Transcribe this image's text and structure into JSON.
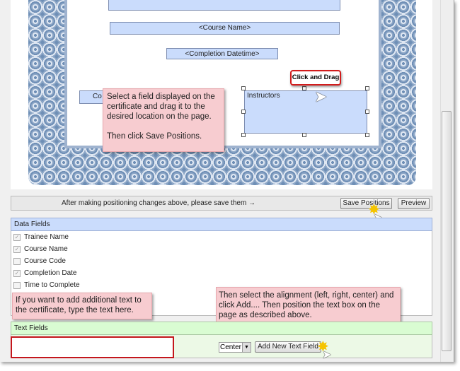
{
  "certificate": {
    "fields": {
      "course_name": "<Course Name>",
      "completion_datetime": "<Completion Datetime>",
      "course_code_partial": "Co",
      "instructors": "Instructors"
    }
  },
  "callouts": {
    "drag_bubble": "Click and Drag",
    "select_field": "Select a field displayed on the certificate and drag it to the desired location on the page.",
    "then_save": "Then click Save Positions.",
    "add_text": "If you want to add additional text to the certificate, type the text here.",
    "alignment": "Then select the alignment (left, right, center) and click Add.... Then position the text box on the page as described above."
  },
  "savebar": {
    "message": "After making positioning changes above, please save them →",
    "save_label": "Save Positions",
    "preview_label": "Preview"
  },
  "data_fields": {
    "title": "Data Fields",
    "items": [
      {
        "label": "Trainee Name",
        "checked": true
      },
      {
        "label": "Course Name",
        "checked": true
      },
      {
        "label": "Course Code",
        "checked": false
      },
      {
        "label": "Completion Date",
        "checked": true
      },
      {
        "label": "Time to Complete",
        "checked": false
      }
    ]
  },
  "text_fields": {
    "title": "Text Fields",
    "input_value": "",
    "alignment_selected": "Center",
    "add_label": "Add New Text Field"
  },
  "colors": {
    "data_header": "#cadcfc",
    "text_header": "#d9fcd2",
    "callout": "#f7ccd0",
    "highlight": "#c4161c"
  }
}
